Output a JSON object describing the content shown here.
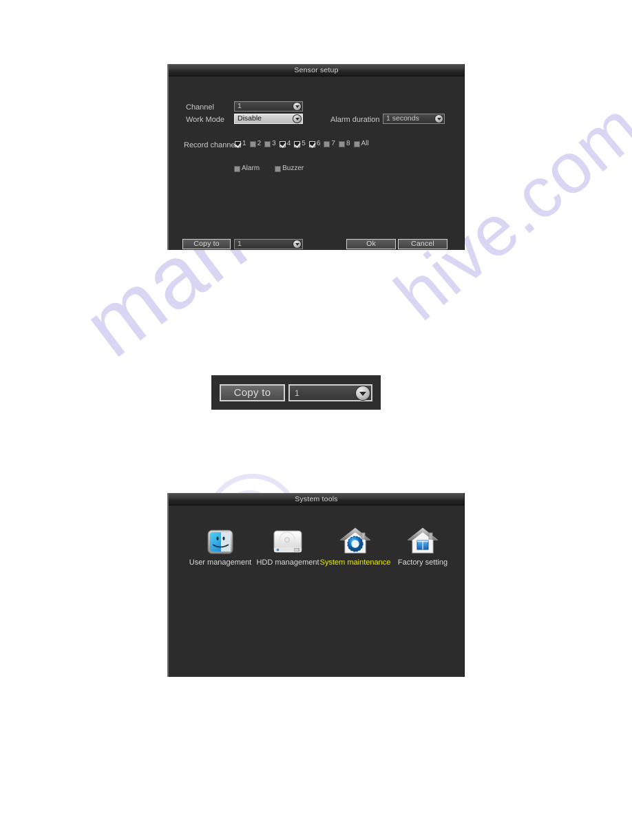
{
  "page": {
    "background_color": "#ffffff",
    "watermark_text_left": "manuals",
    "watermark_text_right": "hive.com",
    "watermark_color": "#b9b6e8"
  },
  "sensor_setup": {
    "title": "Sensor setup",
    "fields": {
      "channel_label": "Channel",
      "channel_value": "1",
      "work_mode_label": "Work Mode",
      "work_mode_value": "Disable",
      "alarm_duration_label": "Alarm duration",
      "alarm_duration_value": "1 seconds",
      "record_channel_label": "Record channel"
    },
    "record_channels": [
      {
        "label": "1",
        "checked": true
      },
      {
        "label": "2",
        "checked": false
      },
      {
        "label": "3",
        "checked": false
      },
      {
        "label": "4",
        "checked": true
      },
      {
        "label": "5",
        "checked": true
      },
      {
        "label": "6",
        "checked": true
      },
      {
        "label": "7",
        "checked": false
      },
      {
        "label": "8",
        "checked": false
      },
      {
        "label": "All",
        "checked": false
      }
    ],
    "options": [
      {
        "label": "Alarm",
        "checked": false
      },
      {
        "label": "Buzzer",
        "checked": false
      }
    ],
    "footer": {
      "copy_to_label": "Copy to",
      "copy_to_value": "1",
      "ok_label": "Ok",
      "cancel_label": "Cancel"
    }
  },
  "copy_to_callout": {
    "button_label": "Copy to",
    "combo_value": "1"
  },
  "system_tools": {
    "title": "System tools",
    "items": [
      {
        "label": "User management",
        "icon": "finder-face-icon",
        "active": false
      },
      {
        "label": "HDD management",
        "icon": "hard-drive-icon",
        "active": false
      },
      {
        "label": "System maintenance",
        "icon": "house-gear-icon",
        "active": true
      },
      {
        "label": "Factory setting",
        "icon": "house-window-icon",
        "active": false
      }
    ],
    "active_color": "#e8e80d"
  }
}
